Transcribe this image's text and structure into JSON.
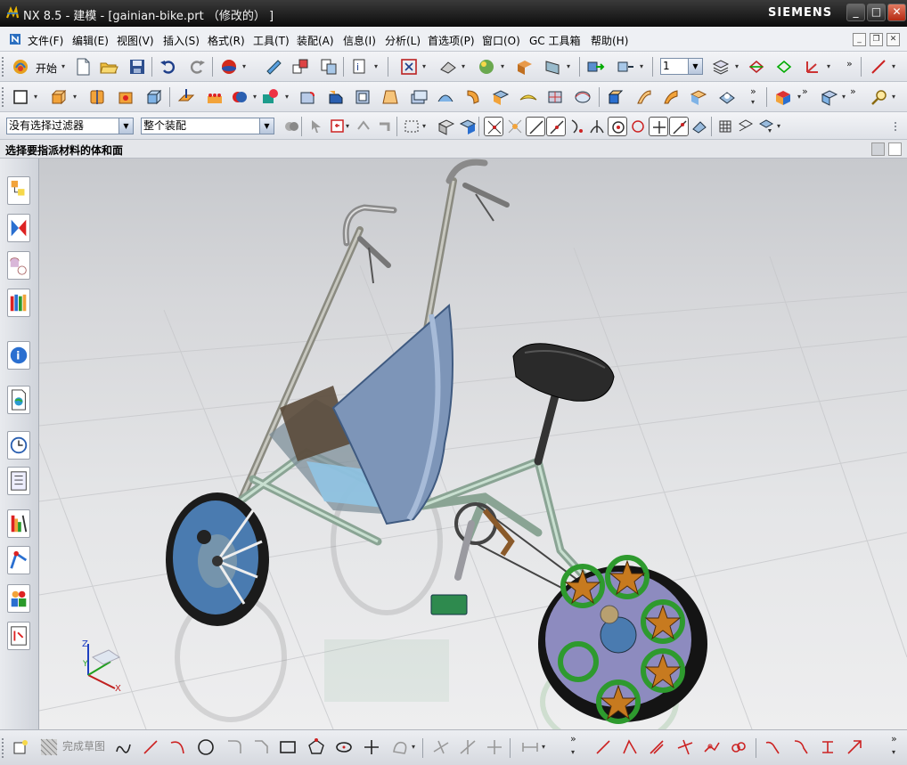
{
  "window": {
    "title": "NX 8.5 - 建模 - [gainian-bike.prt （修改的） ]",
    "brand": "SIEMENS",
    "buttons": {
      "minimize": "_",
      "maximize": "□",
      "close": "✕"
    }
  },
  "menu": {
    "items": [
      "文件(F)",
      "编辑(E)",
      "视图(V)",
      "插入(S)",
      "格式(R)",
      "工具(T)",
      "装配(A)",
      "信息(I)",
      "分析(L)",
      "首选项(P)",
      "窗口(O)",
      "GC 工具箱",
      "帮助(H)"
    ]
  },
  "standard_toolbar": {
    "start_label": "开始",
    "layer_value": "1"
  },
  "selection_bar": {
    "filter_value": "没有选择过滤器",
    "scope_value": "整个装配"
  },
  "cue_line": {
    "text": "选择要指派材料的体和面"
  },
  "resource_bar": {
    "icons": [
      "assembly-navigator-icon",
      "constraint-navigator-icon",
      "part-navigator-icon",
      "reuse-library-icon",
      "hd3d-tools-icon",
      "web-browser-icon",
      "history-icon",
      "process-studio-icon",
      "manufacturing-wizard-icon",
      "roles-icon",
      "system-materials-icon",
      "system-scenes-icon"
    ]
  },
  "viewport": {
    "triad": {
      "x": "X",
      "y": "Y",
      "z": "Z"
    },
    "colors": {
      "frame": "#a9c9b4",
      "canopy": "#7d95b8",
      "seat": "#2a2a2a",
      "front_wheel_disc": "#4a7bb0",
      "rear_wheel_disc": "#8d8bbf",
      "star_rings": "#2e9a2e",
      "stars": "#c77a1f"
    }
  },
  "sketch_toolbar": {
    "finish_sketch_label": "完成草图"
  }
}
